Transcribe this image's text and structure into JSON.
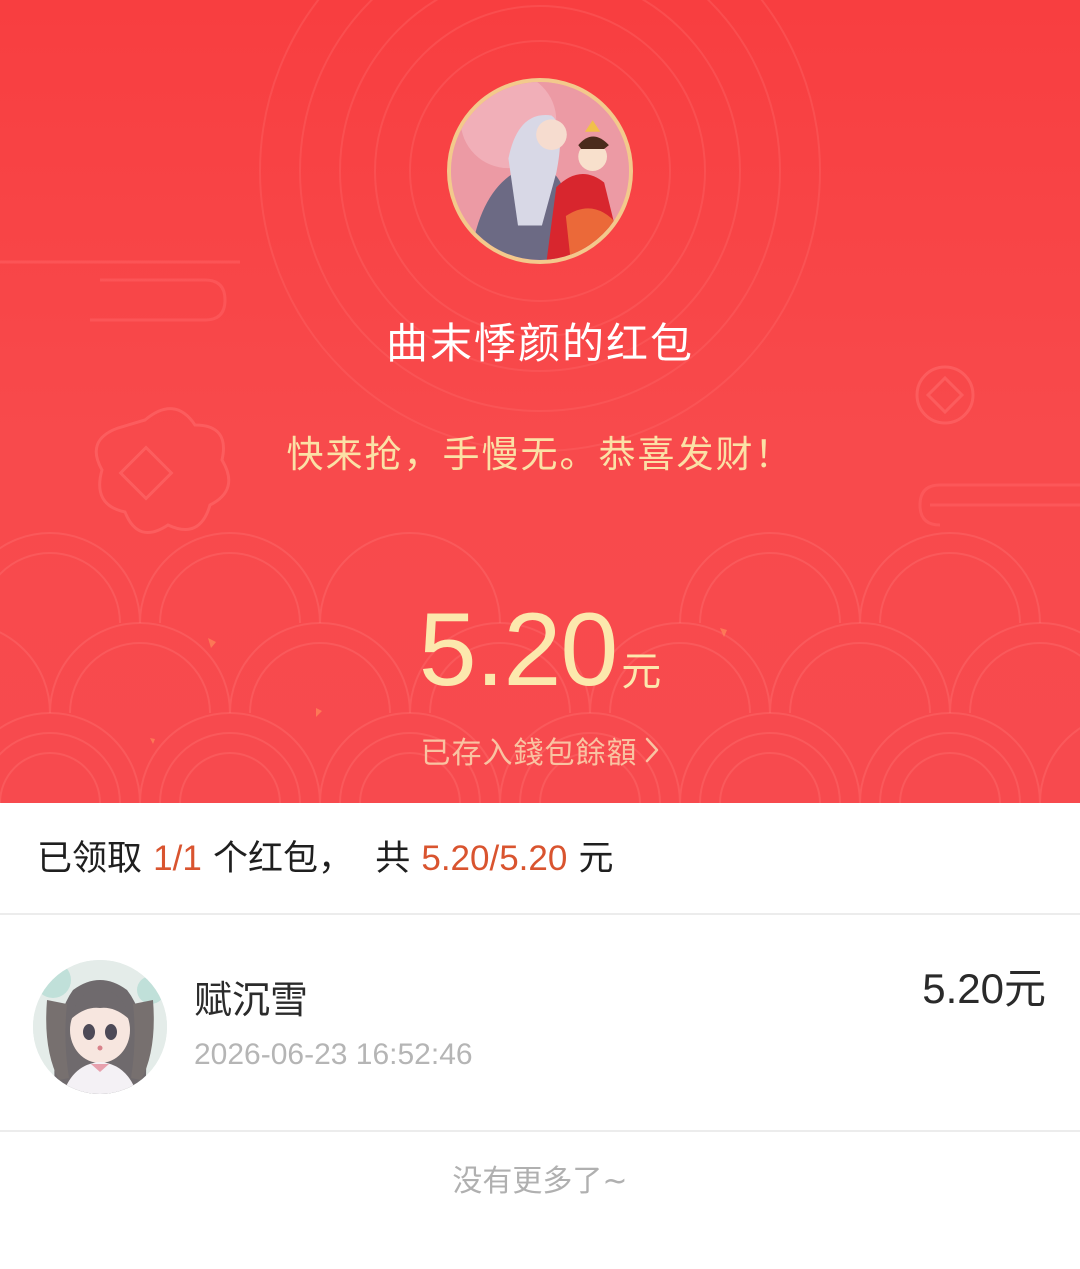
{
  "header": {
    "sender_title": "曲末悸颜的红包",
    "greeting": "快来抢，手慢无。恭喜发财！",
    "amount": "5.20",
    "amount_unit": "元",
    "wallet_link": "已存入錢包餘額",
    "sender_avatar_icon": "sender-avatar-image"
  },
  "summary": {
    "prefix": "已领取",
    "claimed_count": "1/1",
    "middle": "个红包，  共",
    "total": "5.20/5.20",
    "suffix": "元"
  },
  "receivers": [
    {
      "name": "赋沉雪",
      "time": "2026-06-23 16:52:46",
      "amount": "5.20",
      "unit": "元"
    }
  ],
  "footer": {
    "no_more": "没有更多了~"
  },
  "colors": {
    "hero_red": "#f84244",
    "gold_text": "#fce8ad",
    "highlight": "#d9542f"
  }
}
